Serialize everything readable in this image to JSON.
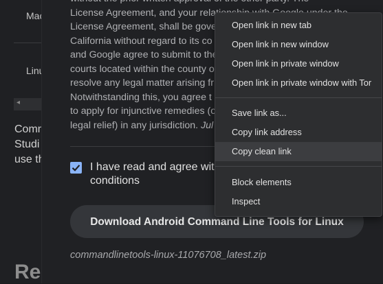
{
  "background_page": {
    "os_mac": "Mac",
    "os_linux": "Linu",
    "intro_lines": [
      "Comm",
      "Studi",
      "use th"
    ],
    "heading_partial": "Re"
  },
  "dialog": {
    "license_lines": [
      "without the prior written approval of the other party. The",
      "License Agreement, and your relationship with Google under the",
      "License Agreement, shall be gove",
      "California without regard to its co",
      "and Google agree to submit to the",
      "courts located within the county o",
      "resolve any legal matter arising fr",
      "Notwithstanding this, you agree t",
      "to apply for injunctive remedies (o",
      "legal relief) in any jurisdiction."
    ],
    "license_date": "Jul",
    "agree_text": "I have read and agree wit",
    "agree_text_line2": "conditions",
    "agree_checked": true,
    "download_button": "Download Android Command Line Tools for Linux",
    "filename": "commandlinetools-linux-11076708_latest.zip"
  },
  "context_menu": {
    "groups": [
      [
        "Open link in new tab",
        "Open link in new window",
        "Open link in private window",
        "Open link in private window with Tor"
      ],
      [
        "Save link as...",
        "Copy link address",
        "Copy clean link"
      ],
      [
        "Block elements",
        "Inspect"
      ]
    ],
    "highlighted": "Copy clean link"
  },
  "colors": {
    "accent": "#8ab4f8",
    "dialog_bg": "#202124",
    "menu_bg": "#2d2e30"
  }
}
